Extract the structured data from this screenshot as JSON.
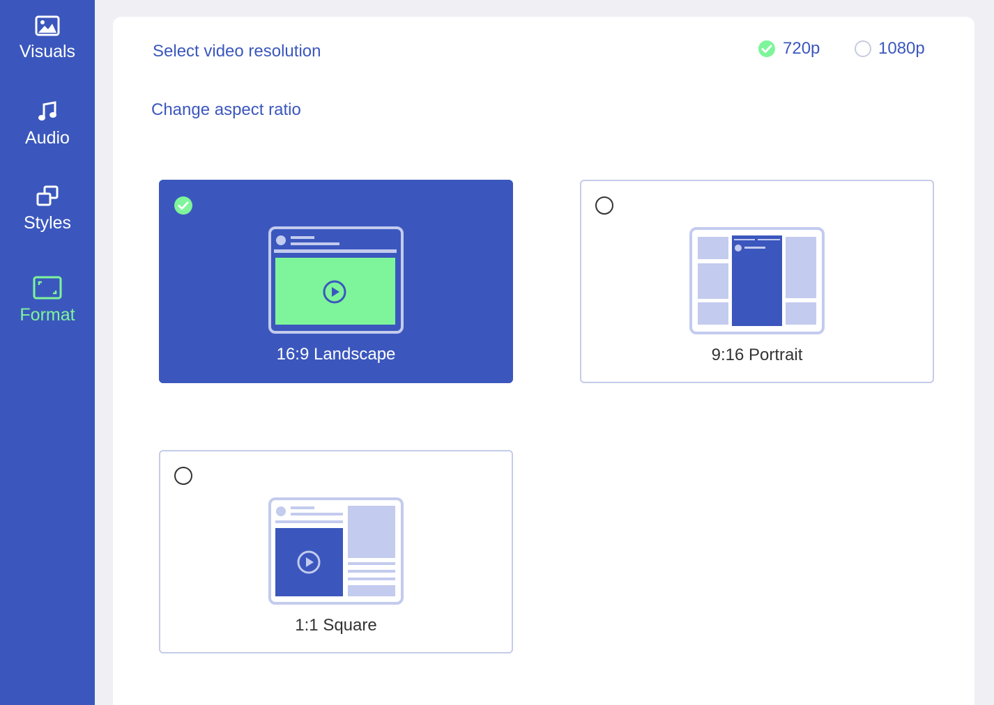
{
  "sidebar": {
    "items": [
      {
        "label": "Visuals",
        "icon": "image-icon",
        "active": false
      },
      {
        "label": "Audio",
        "icon": "music-note-icon",
        "active": false
      },
      {
        "label": "Styles",
        "icon": "layers-icon",
        "active": false
      },
      {
        "label": "Format",
        "icon": "frame-icon",
        "active": true
      }
    ]
  },
  "resolution": {
    "title": "Select video resolution",
    "options": [
      {
        "label": "720p",
        "selected": true
      },
      {
        "label": "1080p",
        "selected": false
      }
    ]
  },
  "aspect": {
    "title": "Change aspect ratio",
    "options": [
      {
        "label": "16:9 Landscape",
        "selected": true
      },
      {
        "label": "9:16 Portrait",
        "selected": false
      },
      {
        "label": "1:1 Square",
        "selected": false
      }
    ]
  },
  "colors": {
    "primary": "#3b57bd",
    "accent_green": "#7ef59a",
    "light_blue": "#c3cbee",
    "background": "#efeff4"
  }
}
